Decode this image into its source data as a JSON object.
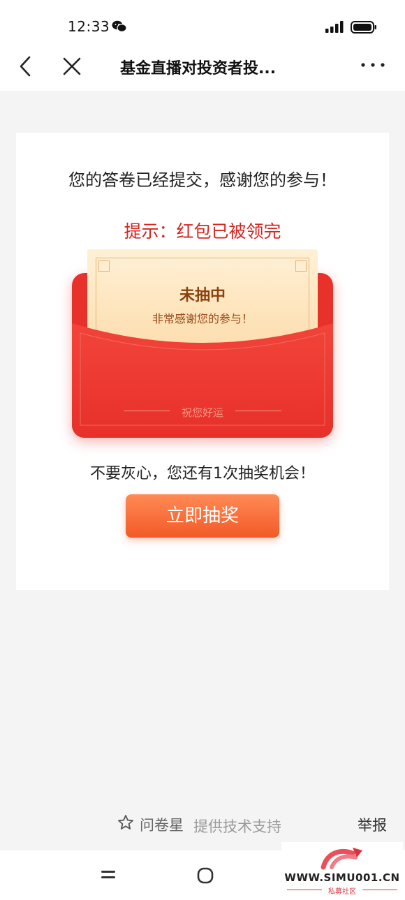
{
  "status_bar": {
    "time": "12:33",
    "icons": [
      "wechat-icon",
      "signal-icon",
      "battery-icon"
    ]
  },
  "nav": {
    "title": "基金直播对投资者投...",
    "icons": [
      "back-arrow-icon",
      "close-icon",
      "more-icon"
    ]
  },
  "card": {
    "submitted_text": "您的答卷已经提交，感谢您的参与！",
    "hint_text": "提示：红包已被领完",
    "envelope": {
      "result_title": "未抽中",
      "result_subtitle": "非常感谢您的参与！",
      "blessing": "祝您好运"
    },
    "chance_text": "不要灰心，您还有1次抽奖机会！",
    "draw_button_label": "立即抽奖"
  },
  "footer": {
    "brand": "问卷星",
    "support": "提供技术支持",
    "report": "举报"
  },
  "watermark": {
    "url": "WWW.SIMU001.CN",
    "subtitle": "私募社区"
  },
  "colors": {
    "accent_red": "#e8312b",
    "hint_red": "#d42620",
    "button_orange": "#f25a27",
    "letter_cream": "#fff1d6"
  }
}
